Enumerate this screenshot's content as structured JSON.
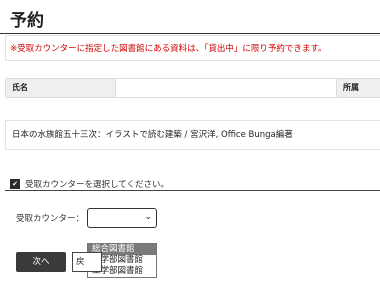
{
  "page": {
    "title": "予約"
  },
  "notice": {
    "text": "※受取カウンターに指定した図書館にある資料は、「貸出中」に限り予約できます。"
  },
  "user_table": {
    "name_label": "氏名",
    "name_value": "",
    "affiliation_label": "所属"
  },
  "book": {
    "title": "日本の水族館五十三次：イラストで読む建築 / 宮沢洋, Office Bunga編著"
  },
  "instruction": {
    "text": "受取カウンターを選択してください。"
  },
  "counter": {
    "label": "受取カウンター：",
    "selected": "",
    "options": [
      "総合図書館",
      "医学部図書館",
      "工学部図書館"
    ]
  },
  "buttons": {
    "next": "次へ",
    "back": "戻"
  },
  "colors": {
    "notice_red": "#d20000",
    "button_dark": "#3a3a3a",
    "option_highlight": "#7a7a7a"
  }
}
